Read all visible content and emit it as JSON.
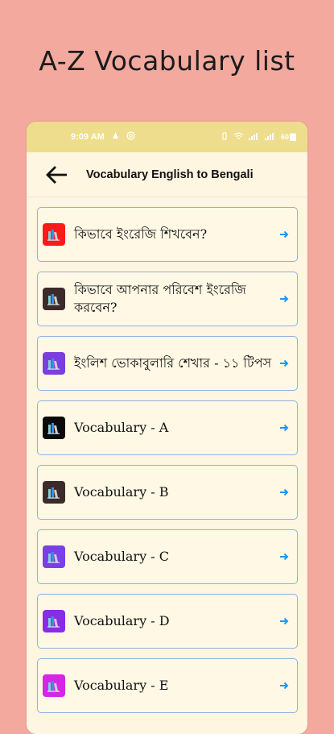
{
  "promo": {
    "title": "A-Z Vocabulary list"
  },
  "status": {
    "time": "9:09 AM",
    "battery": "60"
  },
  "appbar": {
    "title": "Vocabulary English to Bengali"
  },
  "items": [
    {
      "label": "কিভাবে ইংরেজি শিখবেন?",
      "icon_color": "#ff1a1a",
      "icon": "books-icon"
    },
    {
      "label": "কিভাবে আপনার পরিবেশ ইংরেজি করবেন?",
      "icon_color": "#3d2b2b",
      "icon": "books-icon"
    },
    {
      "label": "ইংলিশ ভোকাবুলারি শেখার - ১১ টিপস",
      "icon_color": "#7b3fe0",
      "icon": "books-icon"
    },
    {
      "label": "Vocabulary - A",
      "icon_color": "#0a0a0a",
      "icon": "books-icon"
    },
    {
      "label": "Vocabulary - B",
      "icon_color": "#3d2b2b",
      "icon": "books-icon"
    },
    {
      "label": "Vocabulary - C",
      "icon_color": "#7a3fe8",
      "icon": "books-icon"
    },
    {
      "label": "Vocabulary - D",
      "icon_color": "#8a2be8",
      "icon": "books-icon"
    },
    {
      "label": "Vocabulary - E",
      "icon_color": "#d824e8",
      "icon": "books-icon"
    }
  ],
  "colors": {
    "background": "#f4a99e",
    "statusbar": "#eedd8c",
    "card_border": "#8fb3df",
    "arrow": "#2196f3"
  }
}
